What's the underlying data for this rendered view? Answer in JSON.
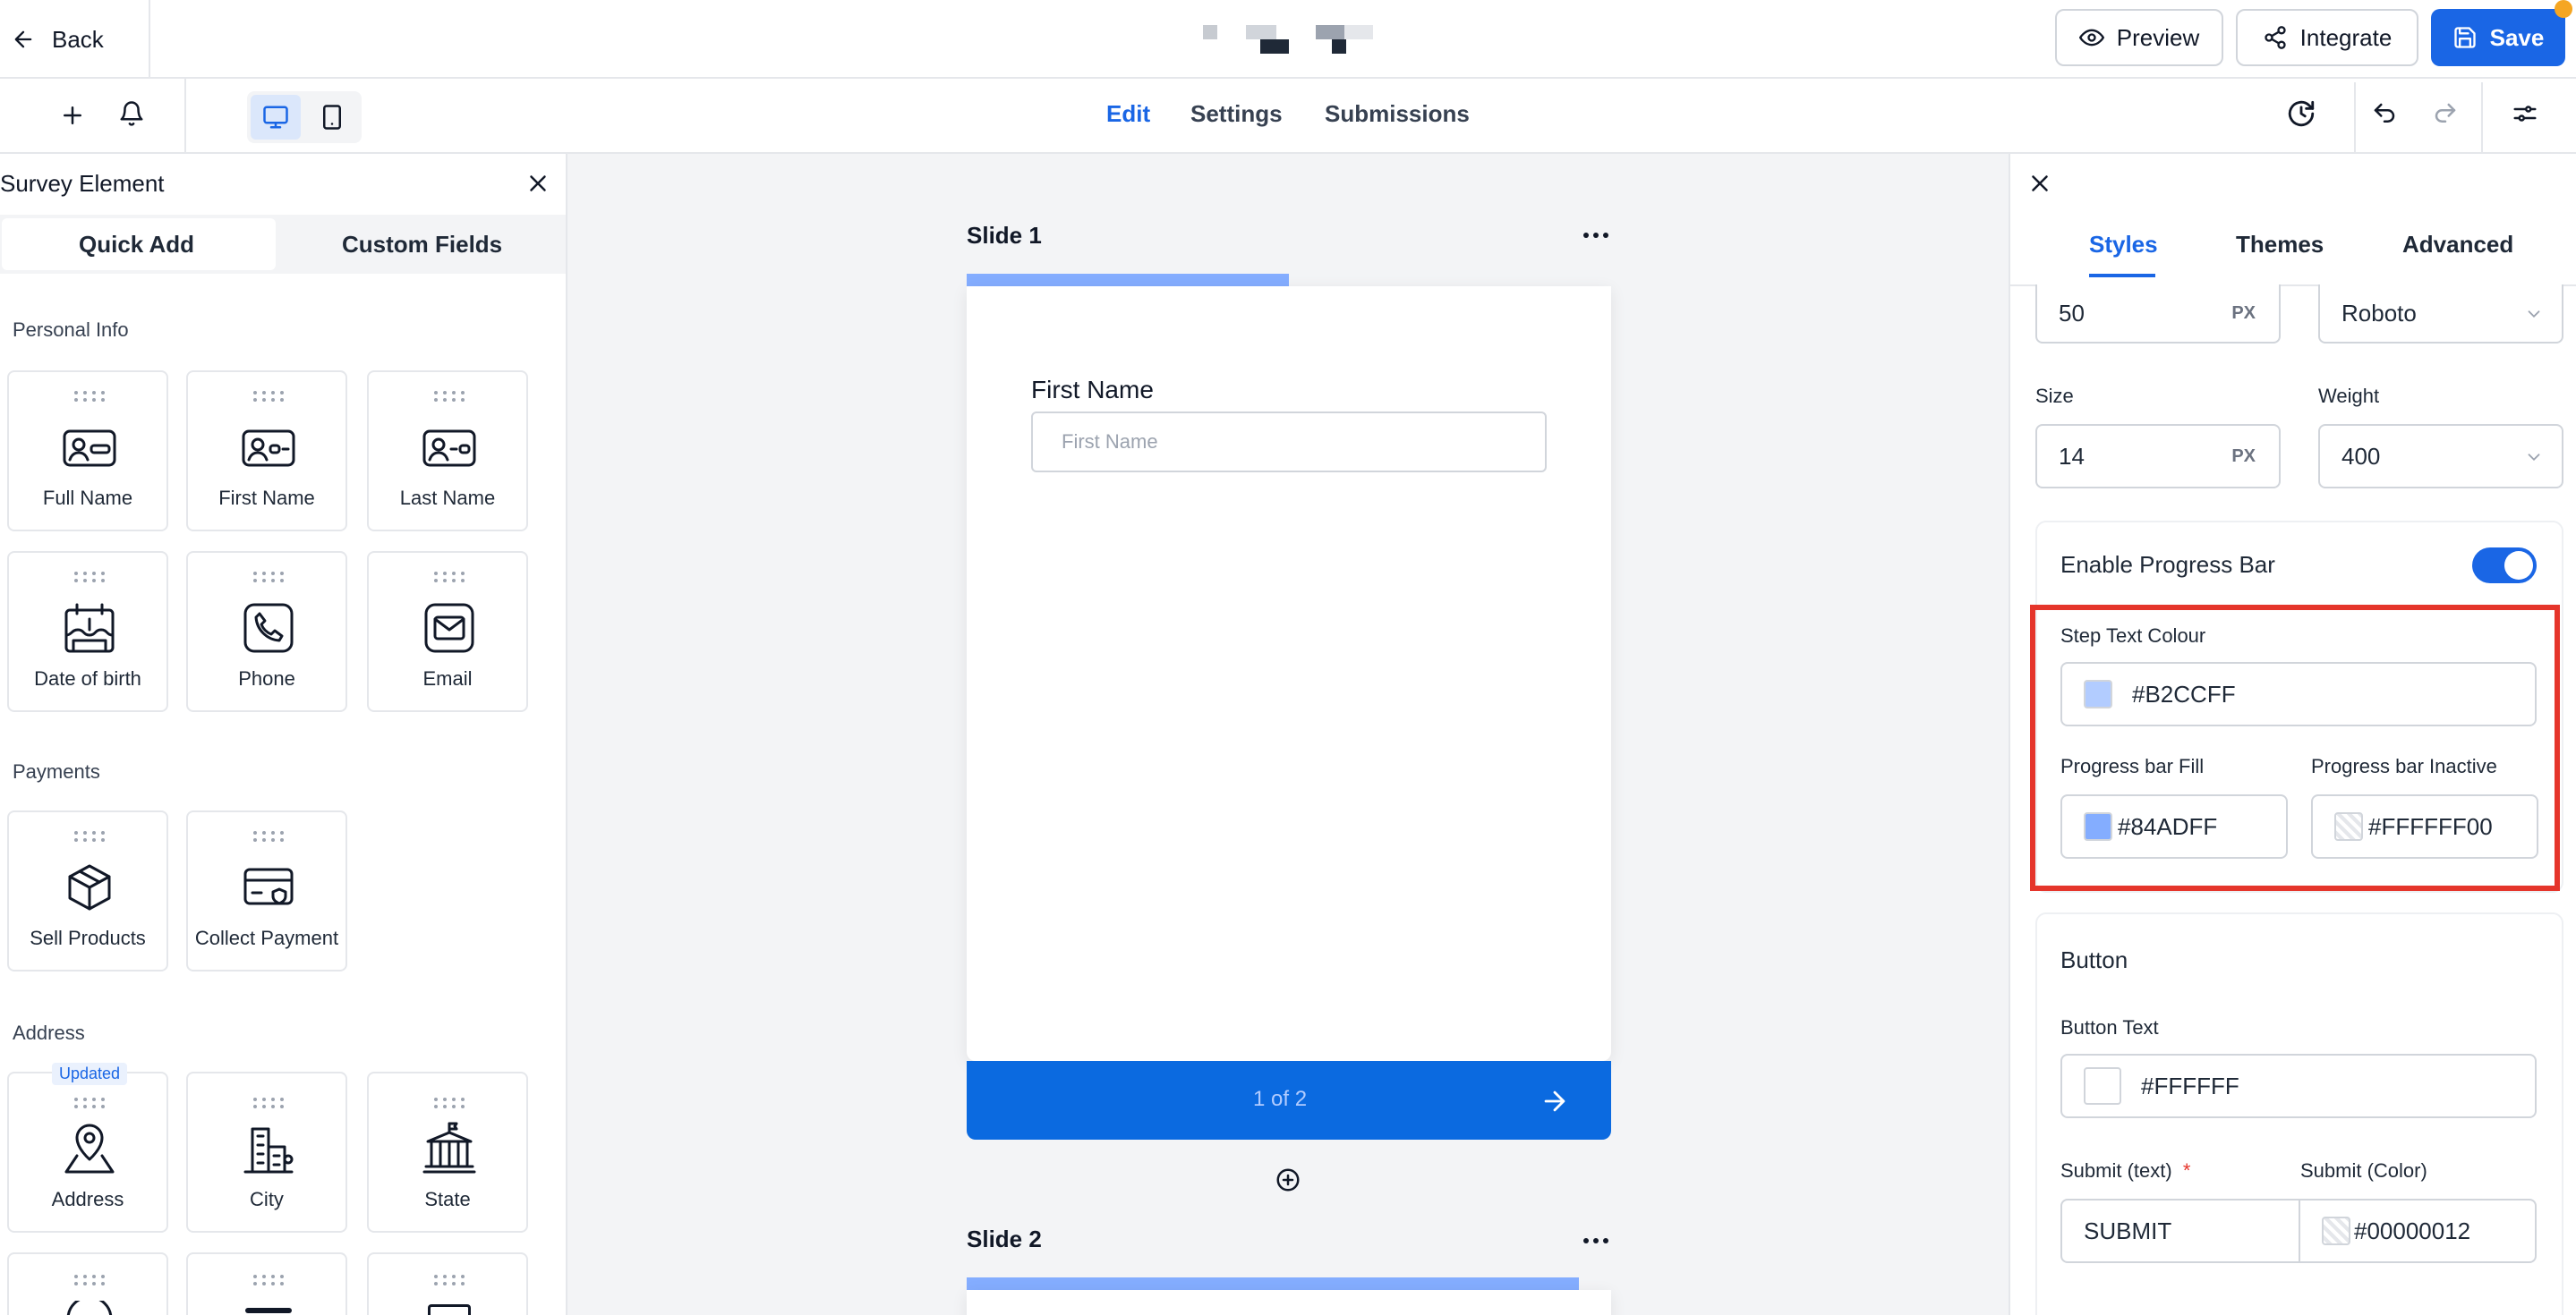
{
  "header": {
    "back_label": "Back",
    "preview_label": "Preview",
    "integrate_label": "Integrate",
    "save_label": "Save"
  },
  "toolbar": {
    "tabs": [
      {
        "label": "Edit",
        "active": true
      },
      {
        "label": "Settings",
        "active": false
      },
      {
        "label": "Submissions",
        "active": false
      }
    ]
  },
  "left_panel": {
    "title": "Survey Element",
    "tabs": [
      {
        "label": "Quick Add",
        "active": true
      },
      {
        "label": "Custom Fields",
        "active": false
      }
    ],
    "sections": [
      {
        "heading": "Personal Info",
        "items": [
          {
            "label": "Full Name",
            "icon": "id-card-icon"
          },
          {
            "label": "First Name",
            "icon": "id-card-icon"
          },
          {
            "label": "Last Name",
            "icon": "id-card-icon"
          },
          {
            "label": "Date of birth",
            "icon": "birthday-cake-icon"
          },
          {
            "label": "Phone",
            "icon": "phone-icon"
          },
          {
            "label": "Email",
            "icon": "mail-icon"
          }
        ]
      },
      {
        "heading": "Payments",
        "items": [
          {
            "label": "Sell Products",
            "icon": "box-icon"
          },
          {
            "label": "Collect Payment",
            "icon": "credit-card-icon"
          }
        ]
      },
      {
        "heading": "Address",
        "items": [
          {
            "label": "Address",
            "icon": "map-pin-icon",
            "badge": "Updated"
          },
          {
            "label": "City",
            "icon": "buildings-icon"
          },
          {
            "label": "State",
            "icon": "landmark-icon"
          }
        ]
      }
    ]
  },
  "canvas": {
    "slides": [
      {
        "title": "Slide 1",
        "field_label": "First Name",
        "field_placeholder": "First Name",
        "step_text": "1 of 2"
      },
      {
        "title": "Slide 2"
      }
    ]
  },
  "right_panel": {
    "tabs": [
      {
        "label": "Styles",
        "active": true
      },
      {
        "label": "Themes",
        "active": false
      },
      {
        "label": "Advanced",
        "active": false
      }
    ],
    "top_size_value": "50",
    "top_unit": "PX",
    "font_family": "Roboto",
    "size_label": "Size",
    "size_value": "14",
    "size_unit": "PX",
    "weight_label": "Weight",
    "weight_value": "400",
    "progress": {
      "enable_label": "Enable Progress Bar",
      "enabled": true,
      "step_text_colour_label": "Step Text Colour",
      "step_text_colour": "#B2CCFF",
      "fill_label": "Progress bar Fill",
      "fill_colour": "#84ADFF",
      "inactive_label": "Progress bar Inactive",
      "inactive_colour": "#FFFFFF00"
    },
    "button": {
      "heading": "Button",
      "text_label": "Button Text",
      "text_colour": "#FFFFFF",
      "submit_text_label": "Submit (text)",
      "required_mark": "*",
      "submit_text_value": "SUBMIT",
      "submit_color_label": "Submit (Color)",
      "submit_color_value": "#00000012"
    }
  },
  "colors": {
    "accent": "#1a66e5",
    "highlight_border": "#e5352b",
    "progress_fill": "#84ADFF",
    "step_text": "#B2CCFF"
  }
}
